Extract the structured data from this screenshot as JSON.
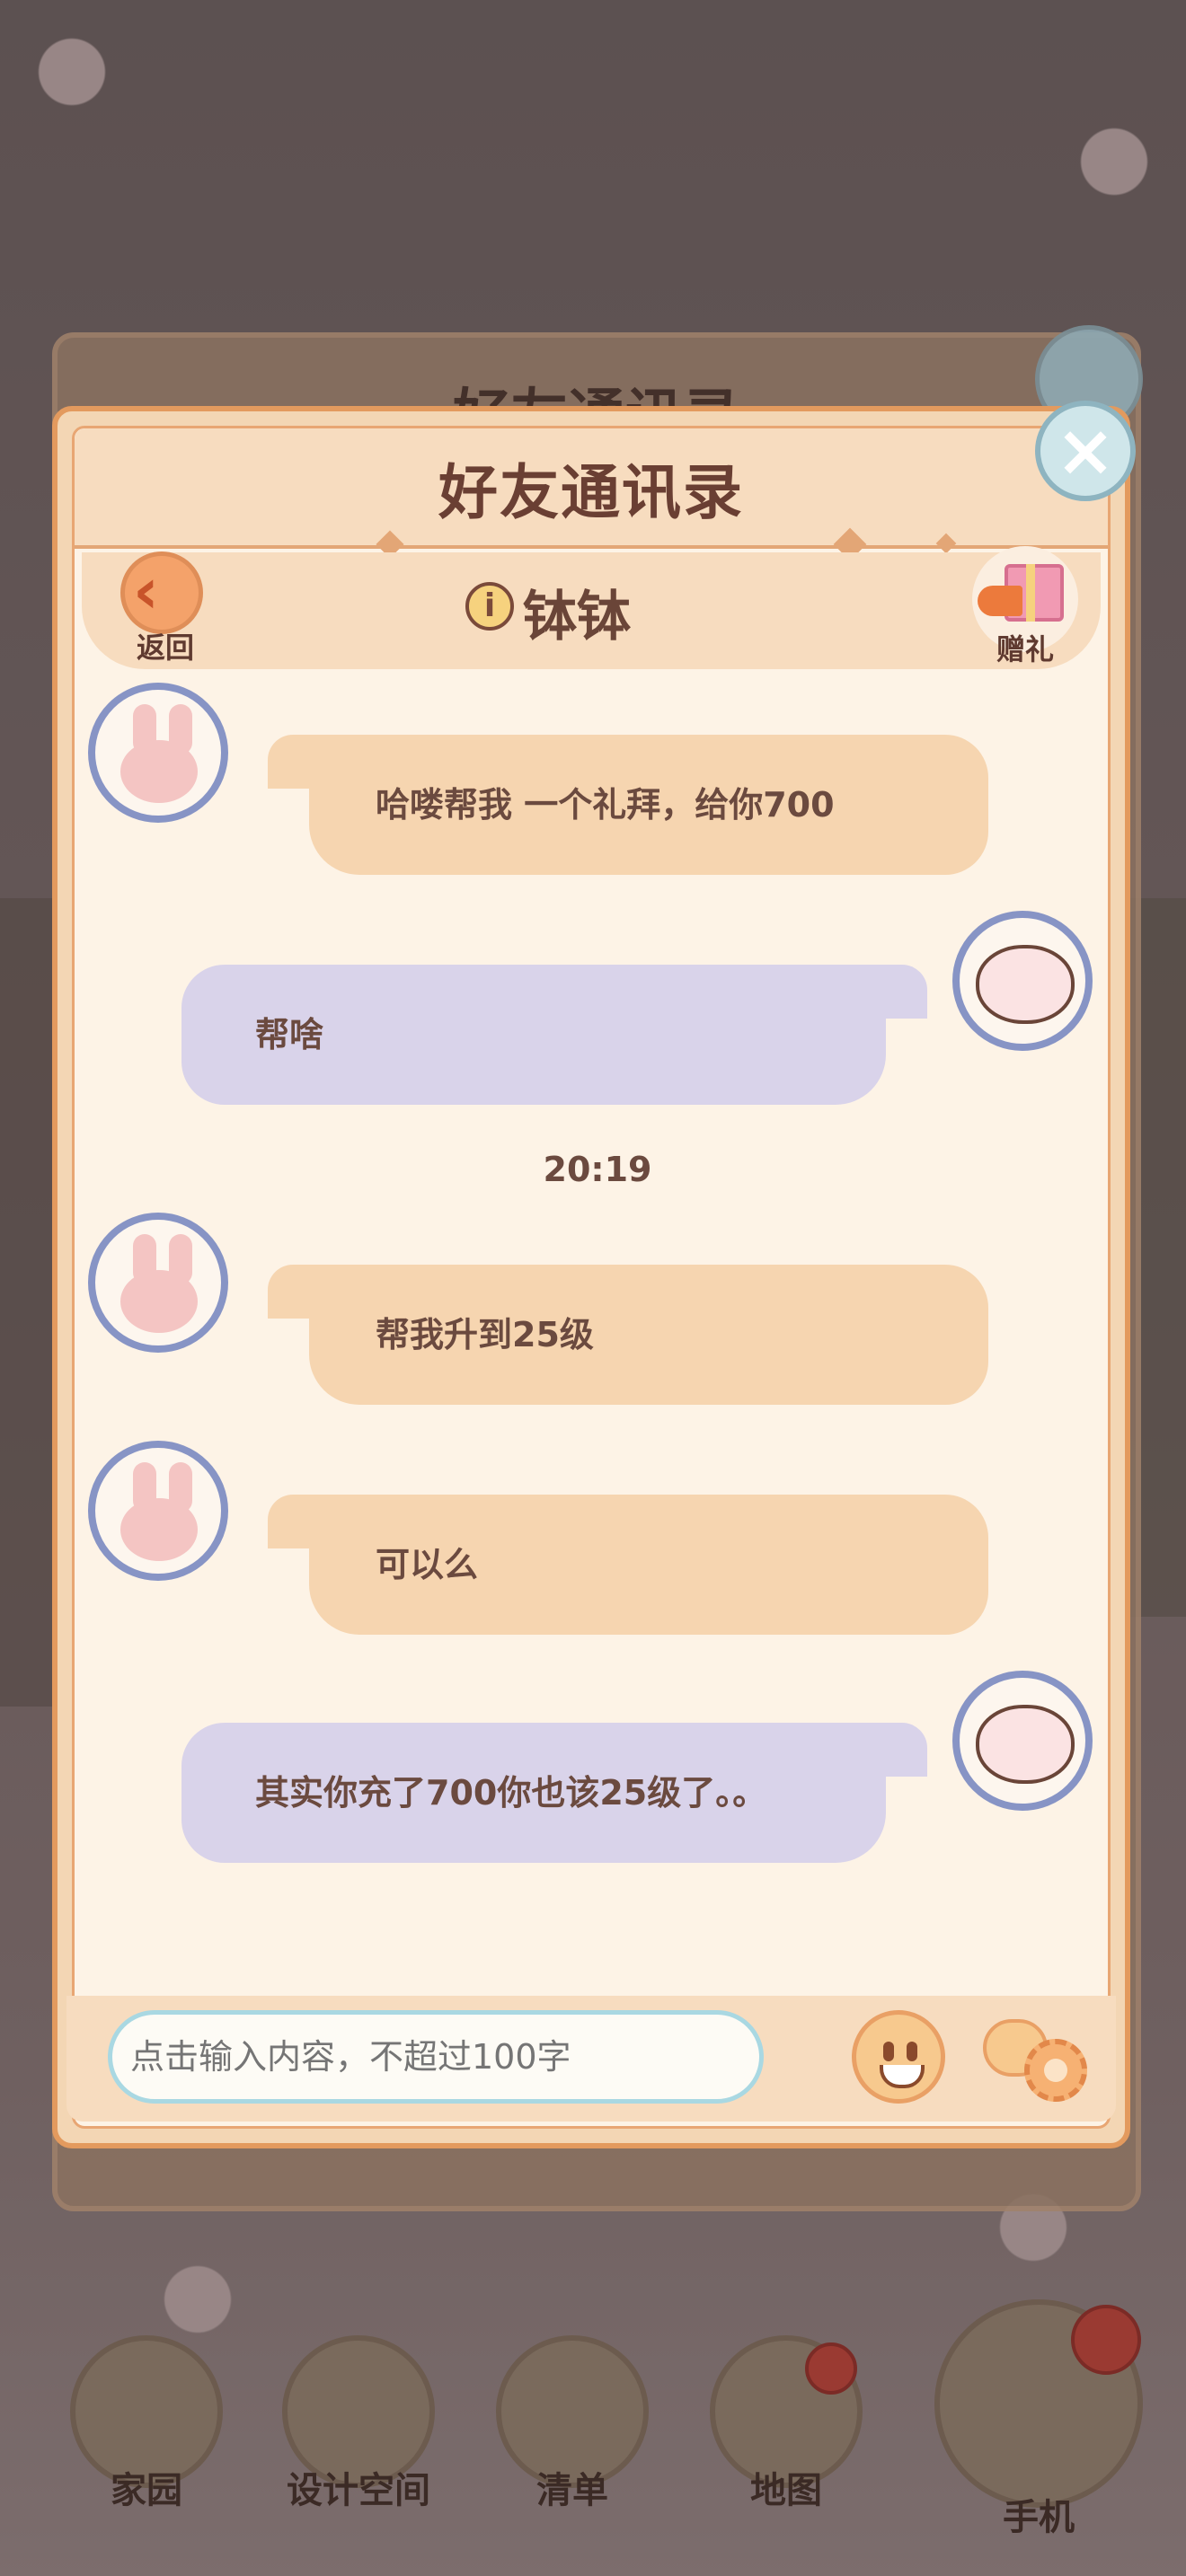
{
  "dialog": {
    "title": "好友通讯录",
    "back_label": "返回",
    "friend_name": "钵钵",
    "gift_label": "赠礼",
    "close_icon": "close-icon"
  },
  "chat": {
    "messages": [
      {
        "from": "friend",
        "text": "哈喽帮我 一个礼拜，给你700"
      },
      {
        "from": "me",
        "text": "帮啥"
      },
      {
        "from": "friend",
        "text": "帮我升到25级"
      },
      {
        "from": "friend",
        "text": "可以么"
      },
      {
        "from": "me",
        "text": "其实你充了700你也该25级了。。"
      }
    ],
    "timestamp": "20:19"
  },
  "input": {
    "placeholder": "点击输入内容，不超过100字"
  },
  "bottom_nav": {
    "items": [
      {
        "label": "家园"
      },
      {
        "label": "设计空间"
      },
      {
        "label": "清单"
      },
      {
        "label": "地图"
      },
      {
        "label": "手机"
      }
    ]
  },
  "colors": {
    "panel_bg": "#f3d6b4",
    "panel_border": "#e39a5e",
    "chat_bg": "#fdf3e6",
    "friend_bubble": "#f6d5b0",
    "my_bubble": "#d9d3ea",
    "text": "#6b4a3f"
  }
}
